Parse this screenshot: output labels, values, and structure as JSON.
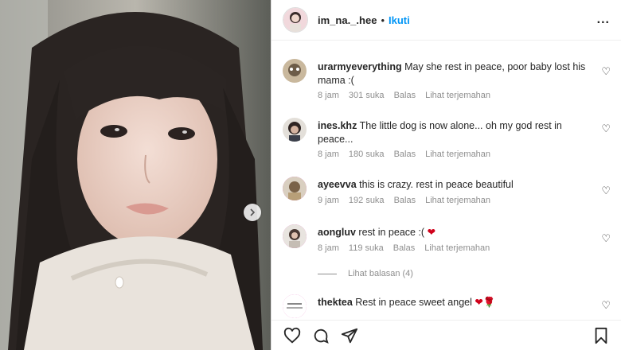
{
  "header": {
    "username": "im_na._.hee",
    "separator": "•",
    "follow_label": "Ikuti",
    "more_label": "..."
  },
  "comments": [
    {
      "username": "urarmyeverything",
      "text": "May she rest in peace, poor baby lost his mama :(",
      "time": "8 jam",
      "likes": "301 suka",
      "reply": "Balas",
      "translate": "Lihat terjemahan"
    },
    {
      "username": "ines.khz",
      "text": "The little dog is now alone... oh my god rest in peace...",
      "time": "8 jam",
      "likes": "180 suka",
      "reply": "Balas",
      "translate": "Lihat terjemahan"
    },
    {
      "username": "ayeevva",
      "text": "this is crazy. rest in peace beautiful",
      "time": "9 jam",
      "likes": "192 suka",
      "reply": "Balas",
      "translate": "Lihat terjemahan"
    },
    {
      "username": "aongluv",
      "text": "rest in peace :(",
      "emoji": "❤",
      "time": "8 jam",
      "likes": "119 suka",
      "reply": "Balas",
      "translate": "Lihat terjemahan"
    },
    {
      "username": "thektea",
      "text": "Rest in peace sweet angel",
      "emoji": "❤🌹"
    }
  ],
  "view_replies": "Lihat balasan (4)",
  "colors": {
    "follow": "#0095f6",
    "story_ring": "#d6249f",
    "emoji_heart": "#d0021b"
  }
}
